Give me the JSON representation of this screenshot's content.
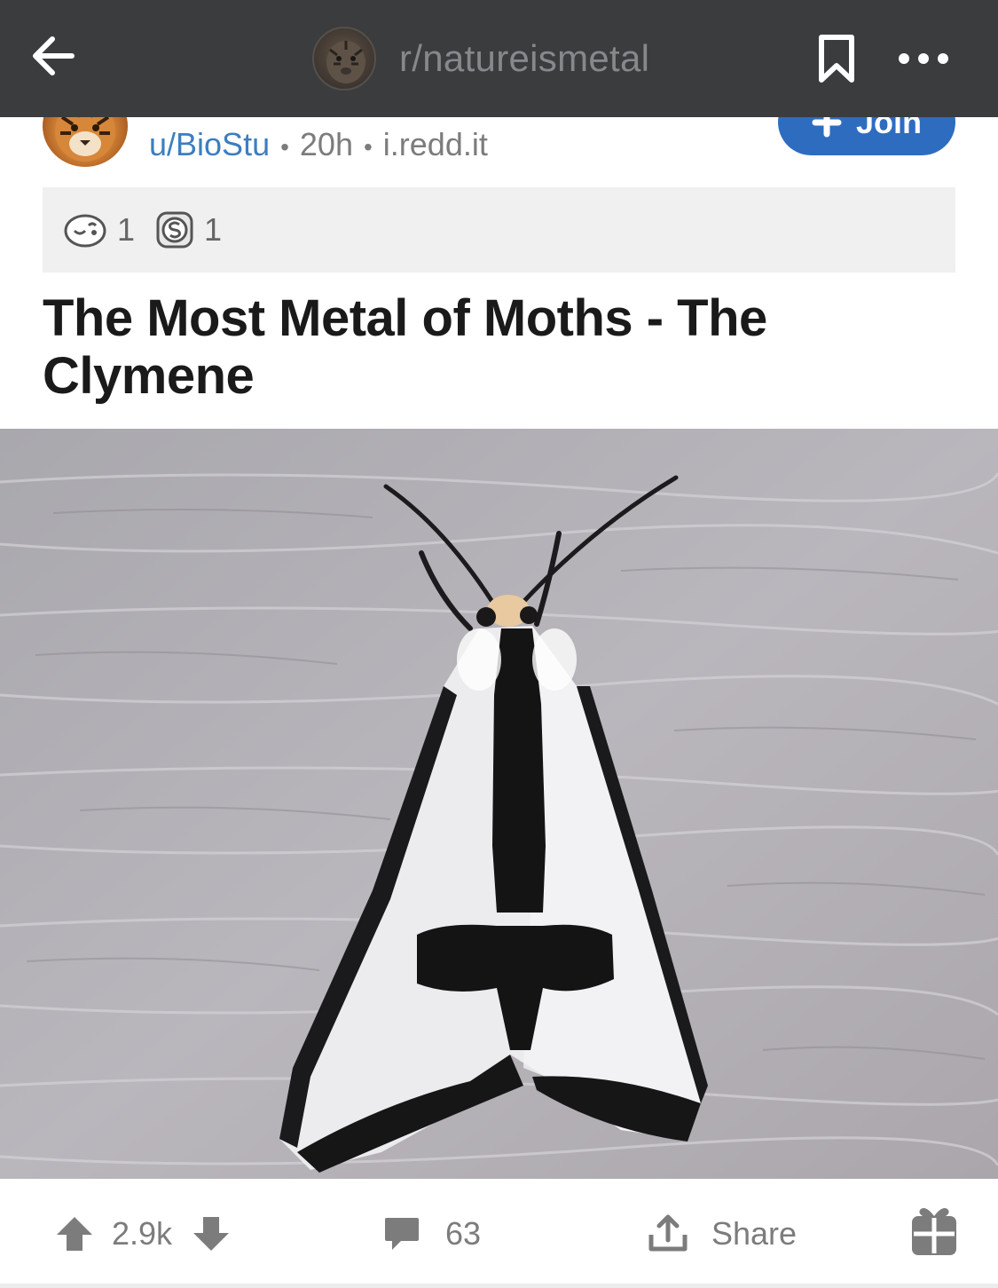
{
  "topbar": {
    "subreddit": "r/natureismetal",
    "icons": {
      "back": "back-arrow-icon",
      "bookmark": "bookmark-icon",
      "more": "more-dots-icon"
    }
  },
  "post": {
    "author": "u/BioStu",
    "age": "20h",
    "domain": "i.redd.it",
    "join_label": "Join",
    "awards": [
      {
        "icon": "wholesome-award-icon",
        "count": "1"
      },
      {
        "icon": "silver-award-icon",
        "count": "1"
      }
    ],
    "title": "The Most Metal of Moths - The Clymene",
    "image_subject": "clymene-moth-photo"
  },
  "actions": {
    "score": "2.9k",
    "comments": "63",
    "share_label": "Share",
    "icons": {
      "upvote": "upvote-arrow-icon",
      "downvote": "downvote-arrow-icon",
      "comment": "comment-bubble-icon",
      "share": "share-icon",
      "award": "gift-award-icon"
    }
  },
  "colors": {
    "topbar_bg": "#3a3c3e",
    "accent_blue": "#2e6cc0",
    "author_link": "#3d7ebf",
    "muted_text": "#7c7c7c"
  }
}
